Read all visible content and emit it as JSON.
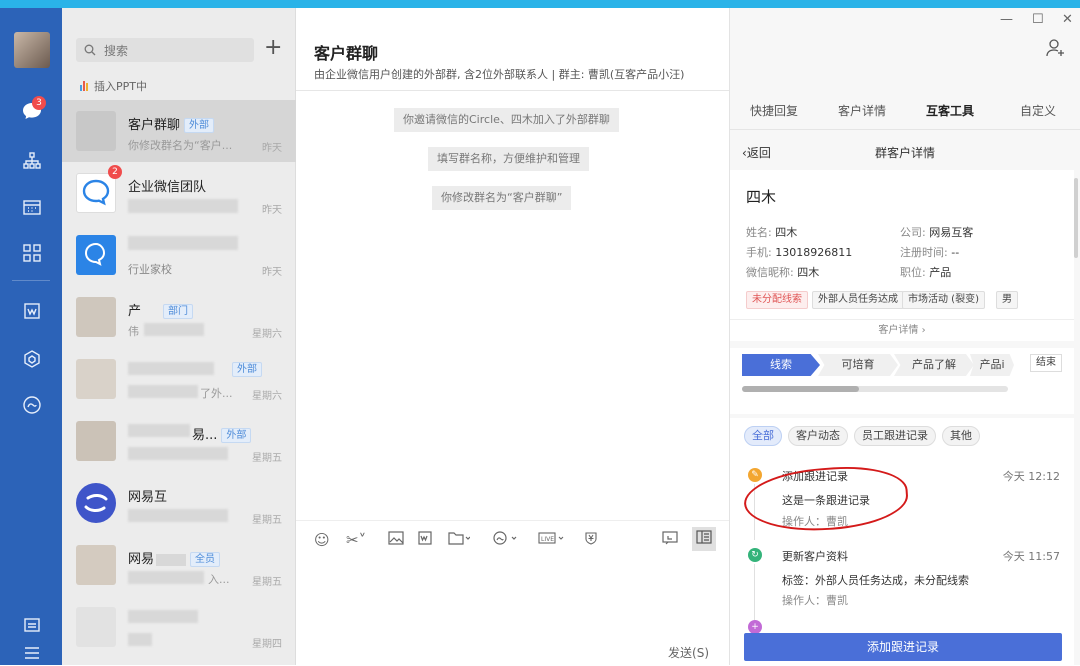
{
  "colors": {
    "rail": "#2c63b8",
    "accent": "#4a6fd8",
    "badge": "#f04c4c",
    "annotation": "#d41a1a"
  },
  "rail": {
    "chat_badge": "3"
  },
  "list": {
    "search_placeholder": "搜索",
    "ppt_label": "插入PPT中",
    "conversations": [
      {
        "name": "客户群聊",
        "tag": "外部",
        "msg": "你修改群名为“客户...",
        "time": "昨天",
        "selected": true
      },
      {
        "name": "企业微信团队",
        "tag": "",
        "msg": "",
        "time": "昨天",
        "badge": "2"
      },
      {
        "name": "",
        "tag": "",
        "msg": "行业家校",
        "time": "昨天"
      },
      {
        "name": "产",
        "tag": "部门",
        "msg": "伟",
        "time": "星期六"
      },
      {
        "name": "",
        "tag": "外部",
        "msg": "了外...",
        "time": "星期六"
      },
      {
        "name": "易...",
        "tag": "外部",
        "msg": "",
        "time": "星期五"
      },
      {
        "name": "网易互",
        "tag": "",
        "msg": "",
        "time": "星期五"
      },
      {
        "name": "网易",
        "tag": "全员",
        "msg": "入...",
        "time": "星期五"
      },
      {
        "name": "",
        "tag": "",
        "msg": "",
        "time": "星期四"
      }
    ]
  },
  "chat": {
    "title": "客户群聊",
    "subtitle": "由企业微信用户创建的外部群, 含2位外部联系人  |  群主: 曹凯(互客产品小汪)",
    "system_messages": [
      "你邀请微信的Circle、四木加入了外部群聊",
      "填写群名称，方便维护和管理",
      "你修改群名为“客户群聊”"
    ],
    "send_label": "发送(S)"
  },
  "panel": {
    "tabs": [
      "快捷回复",
      "客户详情",
      "互客工具",
      "自定义"
    ],
    "active_tab": "互客工具",
    "back_label": "返回",
    "page_title": "群客户详情",
    "customer": {
      "display_name": "四木",
      "name_label": "姓名:",
      "name": "四木",
      "company_label": "公司:",
      "company": "网易互客",
      "phone_label": "手机:",
      "phone": "13018926811",
      "regtime_label": "注册时间:",
      "regtime": "--",
      "wechat_label": "微信昵称:",
      "wechat": "四木",
      "position_label": "职位:",
      "position": "产品",
      "tags": [
        "未分配线索",
        "外部人员任务达成",
        "市场活动 (裂变)",
        "男"
      ],
      "more_label": "客户详情"
    },
    "stages": [
      "线索",
      "可培育",
      "产品了解",
      "产品i"
    ],
    "stage_end": "结束",
    "progress": 0.44,
    "filters": [
      "全部",
      "客户动态",
      "员工跟进记录",
      "其他"
    ],
    "active_filter": "全部",
    "events": [
      {
        "title": "添加跟进记录",
        "time": "今天 12:12",
        "desc": "这是一条跟进记录",
        "operator": "操作人：曹凯"
      },
      {
        "title": "更新客户资料",
        "time": "今天 11:57",
        "desc": "标签：外部人员任务达成，未分配线索",
        "operator": "操作人：曹凯"
      },
      {
        "title": "",
        "time": "",
        "desc": "",
        "operator": ""
      }
    ],
    "add_button": "添加跟进记录"
  }
}
